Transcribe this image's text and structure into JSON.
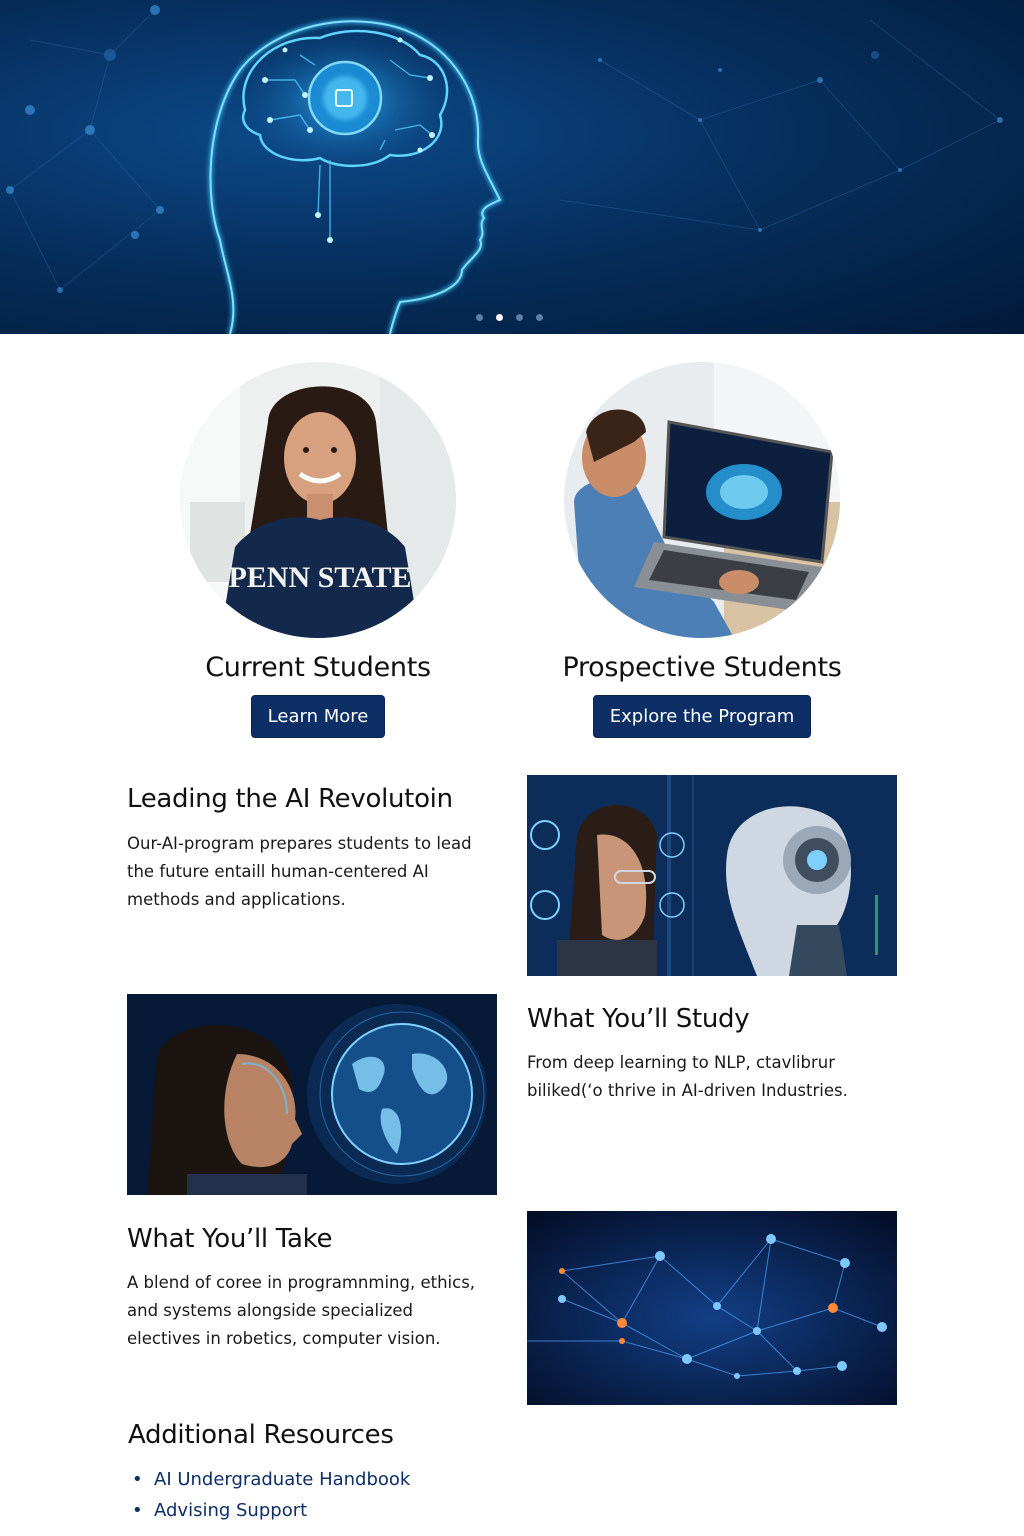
{
  "hero": {
    "carousel_dots": 4,
    "active_dot": 2
  },
  "audiences": [
    {
      "title": "Current Students",
      "button": "Learn More",
      "shirt_text": "PENN STATE"
    },
    {
      "title": "Prospective Students",
      "button": "Explore the Program"
    }
  ],
  "sections": {
    "leading": {
      "title": "Leading the AI Revolutoin",
      "body": "Our-AI-program prepares students to lead the future entaill human-centered AI methods and applications."
    },
    "study": {
      "title": "What You’ll Study",
      "body": "From deep learning to NLP, ctavlibrur biliked(‘o thrive in AI-driven Industries."
    },
    "take": {
      "title": "What You’ll Take",
      "body": "A blend of coree in programnming, ethics, and systems alongside specialized electives in robetics, computer vision."
    }
  },
  "resources": {
    "title": "Additional Resources",
    "links": [
      "AI Undergraduate Handbook",
      "Advising Support"
    ]
  },
  "colors": {
    "primary": "#0d2f66",
    "hero_glow": "#3ec8ff"
  }
}
